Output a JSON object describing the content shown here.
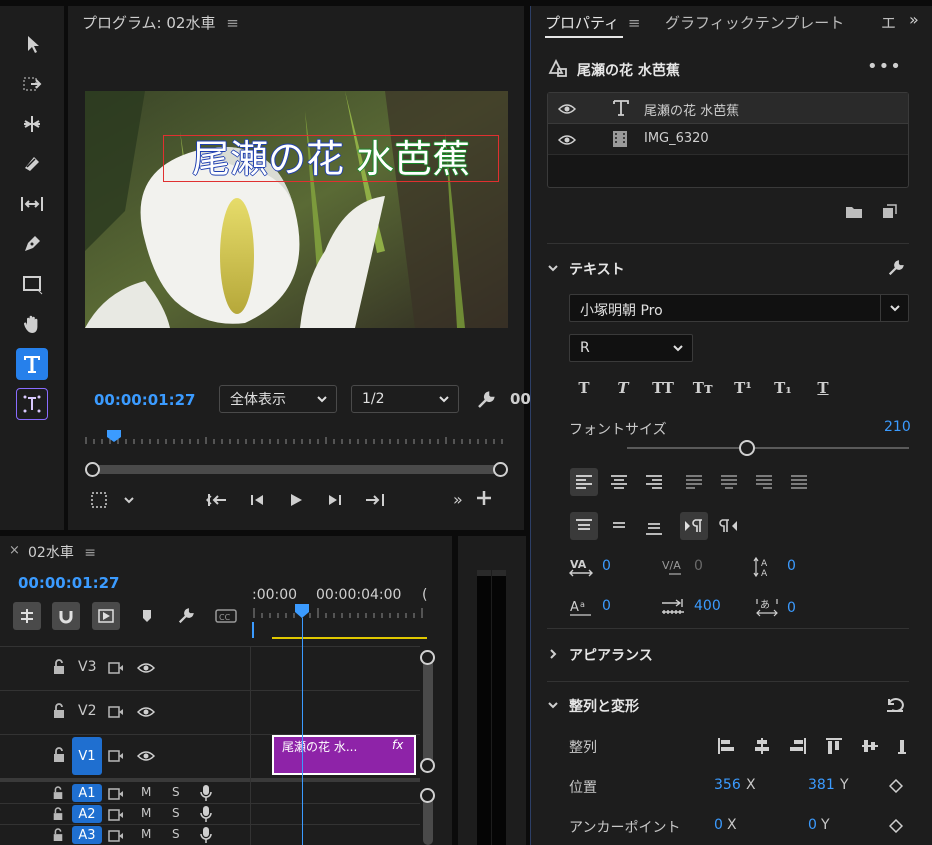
{
  "program": {
    "title": "プログラム: 02水車",
    "timecode": "00:00:01:27",
    "zoom_value": "全体表示",
    "resolution_value": "1/2",
    "overlay": {
      "part1": "尾瀬の花",
      "part2": "水芭蕉"
    }
  },
  "timeline": {
    "tab_title": "02水車",
    "timecode": "00:00:01:27",
    "ruler": {
      "t0": ":00:00",
      "t1": "00:00:04:00",
      "t2": "("
    },
    "tracks": {
      "v3": "V3",
      "v2": "V2",
      "v1": "V1",
      "a1": "A1",
      "a2": "A2",
      "a3": "A3",
      "m": "M",
      "s": "S"
    },
    "clip": {
      "label": "尾瀬の花 水...",
      "fx": "fx"
    }
  },
  "properties": {
    "tabs": {
      "t1": "プロパティ",
      "t2": "グラフィックテンプレート",
      "t3": "エ"
    },
    "header_title": "尾瀬の花 水芭蕉",
    "layers": [
      {
        "name": "尾瀬の花 水芭蕉"
      },
      {
        "name": "IMG_6320"
      }
    ],
    "text_section": {
      "title": "テキスト",
      "font_family": "小塚明朝 Pro",
      "font_style": "R",
      "styles": {
        "b": "T",
        "i": "T",
        "tt": "TT",
        "tt2": "Tт",
        "sup": "T¹",
        "sub": "T₁",
        "u": "T"
      },
      "font_size_label": "フォントサイズ",
      "font_size_value": "210",
      "font_size_fraction": 0.55,
      "tracking": "0",
      "kerning": "0",
      "leading": "0",
      "baseline": "0",
      "tab_width": "400",
      "tsume": "0"
    },
    "appearance_title": "アピアランス",
    "align_section": {
      "title": "整列と変形",
      "align_label": "整列",
      "position_label": "位置",
      "position_x": "356",
      "position_y": "381",
      "anchor_label": "アンカーポイント",
      "anchor_x": "0",
      "anchor_y": "0",
      "x_axis": "X",
      "y_axis": "Y"
    }
  }
}
